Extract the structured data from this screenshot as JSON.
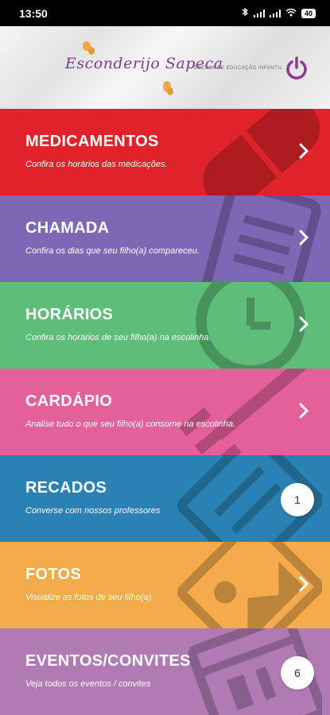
{
  "status_bar": {
    "time": "13:50",
    "battery": "40"
  },
  "header": {
    "logo_text": "Esconderijo Sapeca",
    "subtitle": "ESCOLA DE EDUCAÇÃO INFANTIL",
    "power_icon": "power-icon"
  },
  "menu": [
    {
      "title": "MEDICAMENTOS",
      "description": "Confira os horários das medicações.",
      "color": "#e0232a",
      "icon": "pill-icon",
      "action": "chevron"
    },
    {
      "title": "CHAMADA",
      "description": "Confira os dias que seu filho(a) compareceu.",
      "color": "#7d68b5",
      "icon": "clipboard-icon",
      "action": "chevron"
    },
    {
      "title": "HORÁRIOS",
      "description": "Confira os horários de seu filho(a) na escolinha.",
      "color": "#5dbd79",
      "icon": "clock-icon",
      "action": "chevron"
    },
    {
      "title": "CARDÁPIO",
      "description": "Analise tudo o que seu filho(a) consome na escolinha.",
      "color": "#e4609b",
      "icon": "fork-icon",
      "action": "chevron"
    },
    {
      "title": "RECADOS",
      "description": "Converse com nossos professores",
      "color": "#2a82b4",
      "icon": "message-icon",
      "action": "badge",
      "badge": "1"
    },
    {
      "title": "FOTOS",
      "description": "Visualize as fotos de seu filho(a).",
      "color": "#f3ab4c",
      "icon": "photo-icon",
      "action": "chevron"
    },
    {
      "title": "EVENTOS/CONVITES",
      "description": "Veja todos os eventos / convites",
      "color": "#b07bb5",
      "icon": "calendar-icon",
      "action": "badge",
      "badge": "6"
    }
  ]
}
